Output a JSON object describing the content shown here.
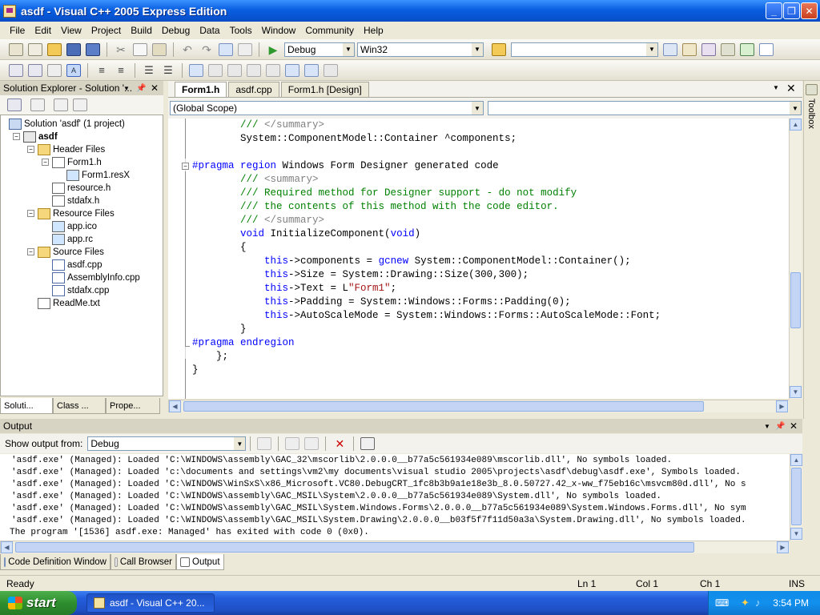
{
  "window": {
    "title": "asdf - Visual C++ 2005 Express Edition",
    "minimize": "_",
    "restore": "❐",
    "close": "✕"
  },
  "menu": [
    "File",
    "Edit",
    "View",
    "Project",
    "Build",
    "Debug",
    "Data",
    "Tools",
    "Window",
    "Community",
    "Help"
  ],
  "toolbar": {
    "config": "Debug",
    "platform": "Win32",
    "find": ""
  },
  "solution_explorer": {
    "title": "Solution Explorer - Solution '...",
    "pin": "📌",
    "close": "✕",
    "tree": [
      {
        "label": "Solution 'asdf' (1 project)",
        "indent": 0,
        "icon": "sol"
      },
      {
        "label": "asdf",
        "indent": 1,
        "icon": "proj",
        "bold": true,
        "expand": "-"
      },
      {
        "label": "Header Files",
        "indent": 2,
        "icon": "folder",
        "expand": "-"
      },
      {
        "label": "Form1.h",
        "indent": 3,
        "icon": "file",
        "expand": "-"
      },
      {
        "label": "Form1.resX",
        "indent": 4,
        "icon": "res"
      },
      {
        "label": "resource.h",
        "indent": 3,
        "icon": "file"
      },
      {
        "label": "stdafx.h",
        "indent": 3,
        "icon": "file"
      },
      {
        "label": "Resource Files",
        "indent": 2,
        "icon": "folder",
        "expand": "-"
      },
      {
        "label": "app.ico",
        "indent": 3,
        "icon": "ico"
      },
      {
        "label": "app.rc",
        "indent": 3,
        "icon": "res"
      },
      {
        "label": "Source Files",
        "indent": 2,
        "icon": "folder",
        "expand": "-"
      },
      {
        "label": "asdf.cpp",
        "indent": 3,
        "icon": "cpp"
      },
      {
        "label": "AssemblyInfo.cpp",
        "indent": 3,
        "icon": "cpp"
      },
      {
        "label": "stdafx.cpp",
        "indent": 3,
        "icon": "cpp"
      },
      {
        "label": "ReadMe.txt",
        "indent": 2,
        "icon": "file"
      }
    ],
    "tabs": [
      "Soluti...",
      "Class ...",
      "Prope..."
    ]
  },
  "editor": {
    "tabs": [
      "Form1.h",
      "asdf.cpp",
      "Form1.h [Design]"
    ],
    "scope": "(Global Scope)",
    "member": "",
    "lines": [
      [
        {
          "t": "        "
        },
        {
          "t": "/// ",
          "c": "cm"
        },
        {
          "t": "</summary>",
          "c": "gr"
        }
      ],
      [
        {
          "t": "        System::ComponentModel::Container ^components;"
        }
      ],
      [
        {
          "t": ""
        }
      ],
      [
        {
          "t": "#pragma",
          "c": "kw"
        },
        {
          "t": " "
        },
        {
          "t": "region",
          "c": "kw"
        },
        {
          "t": " Windows Form Designer generated code"
        }
      ],
      [
        {
          "t": "        "
        },
        {
          "t": "/// ",
          "c": "cm"
        },
        {
          "t": "<summary>",
          "c": "gr"
        }
      ],
      [
        {
          "t": "        "
        },
        {
          "t": "/// Required method for Designer support - do not modify",
          "c": "cm"
        }
      ],
      [
        {
          "t": "        "
        },
        {
          "t": "/// the contents of this method with the code editor.",
          "c": "cm"
        }
      ],
      [
        {
          "t": "        "
        },
        {
          "t": "/// ",
          "c": "cm"
        },
        {
          "t": "</summary>",
          "c": "gr"
        }
      ],
      [
        {
          "t": "        "
        },
        {
          "t": "void",
          "c": "kw"
        },
        {
          "t": " InitializeComponent("
        },
        {
          "t": "void",
          "c": "kw"
        },
        {
          "t": ")"
        }
      ],
      [
        {
          "t": "        {"
        }
      ],
      [
        {
          "t": "            "
        },
        {
          "t": "this",
          "c": "kw"
        },
        {
          "t": "->components = "
        },
        {
          "t": "gcnew",
          "c": "kw"
        },
        {
          "t": " System::ComponentModel::Container();"
        }
      ],
      [
        {
          "t": "            "
        },
        {
          "t": "this",
          "c": "kw"
        },
        {
          "t": "->Size = System::Drawing::Size(300,300);"
        }
      ],
      [
        {
          "t": "            "
        },
        {
          "t": "this",
          "c": "kw"
        },
        {
          "t": "->Text = L"
        },
        {
          "t": "\"Form1\"",
          "c": "st"
        },
        {
          "t": ";"
        }
      ],
      [
        {
          "t": "            "
        },
        {
          "t": "this",
          "c": "kw"
        },
        {
          "t": "->Padding = System::Windows::Forms::Padding(0);"
        }
      ],
      [
        {
          "t": "            "
        },
        {
          "t": "this",
          "c": "kw"
        },
        {
          "t": "->AutoScaleMode = System::Windows::Forms::AutoScaleMode::Font;"
        }
      ],
      [
        {
          "t": "        }"
        }
      ],
      [
        {
          "t": "#pragma",
          "c": "kw"
        },
        {
          "t": " "
        },
        {
          "t": "endregion",
          "c": "kw"
        }
      ],
      [
        {
          "t": "    };"
        }
      ],
      [
        {
          "t": "}"
        }
      ]
    ]
  },
  "output": {
    "title": "Output",
    "show_from_label": "Show output from:",
    "show_from_value": "Debug",
    "lines": [
      "'asdf.exe' (Managed): Loaded 'C:\\WINDOWS\\assembly\\GAC_32\\mscorlib\\2.0.0.0__b77a5c561934e089\\mscorlib.dll', No symbols loaded.",
      "'asdf.exe' (Managed): Loaded 'c:\\documents and settings\\vm2\\my documents\\visual studio 2005\\projects\\asdf\\debug\\asdf.exe', Symbols loaded.",
      "'asdf.exe' (Managed): Loaded 'C:\\WINDOWS\\WinSxS\\x86_Microsoft.VC80.DebugCRT_1fc8b3b9a1e18e3b_8.0.50727.42_x-ww_f75eb16c\\msvcm80d.dll', No s",
      "'asdf.exe' (Managed): Loaded 'C:\\WINDOWS\\assembly\\GAC_MSIL\\System\\2.0.0.0__b77a5c561934e089\\System.dll', No symbols loaded.",
      "'asdf.exe' (Managed): Loaded 'C:\\WINDOWS\\assembly\\GAC_MSIL\\System.Windows.Forms\\2.0.0.0__b77a5c561934e089\\System.Windows.Forms.dll', No sym",
      "'asdf.exe' (Managed): Loaded 'C:\\WINDOWS\\assembly\\GAC_MSIL\\System.Drawing\\2.0.0.0__b03f5f7f11d50a3a\\System.Drawing.dll', No symbols loaded.",
      "The program '[1536] asdf.exe: Managed' has exited with code 0 (0x0)."
    ],
    "tabs": [
      "Code Definition Window",
      "Call Browser",
      "Output"
    ]
  },
  "toolbox_label": "Toolbox",
  "status": {
    "state": "Ready",
    "ln": "Ln 1",
    "col": "Col 1",
    "ch": "Ch 1",
    "mode": "INS"
  },
  "taskbar": {
    "start": "start",
    "item": "asdf - Visual C++ 20...",
    "clock": "3:54 PM"
  },
  "colors": {
    "keyword": "#0000FF",
    "comment": "#008000",
    "xmltag": "#808080",
    "string": "#A31515"
  }
}
